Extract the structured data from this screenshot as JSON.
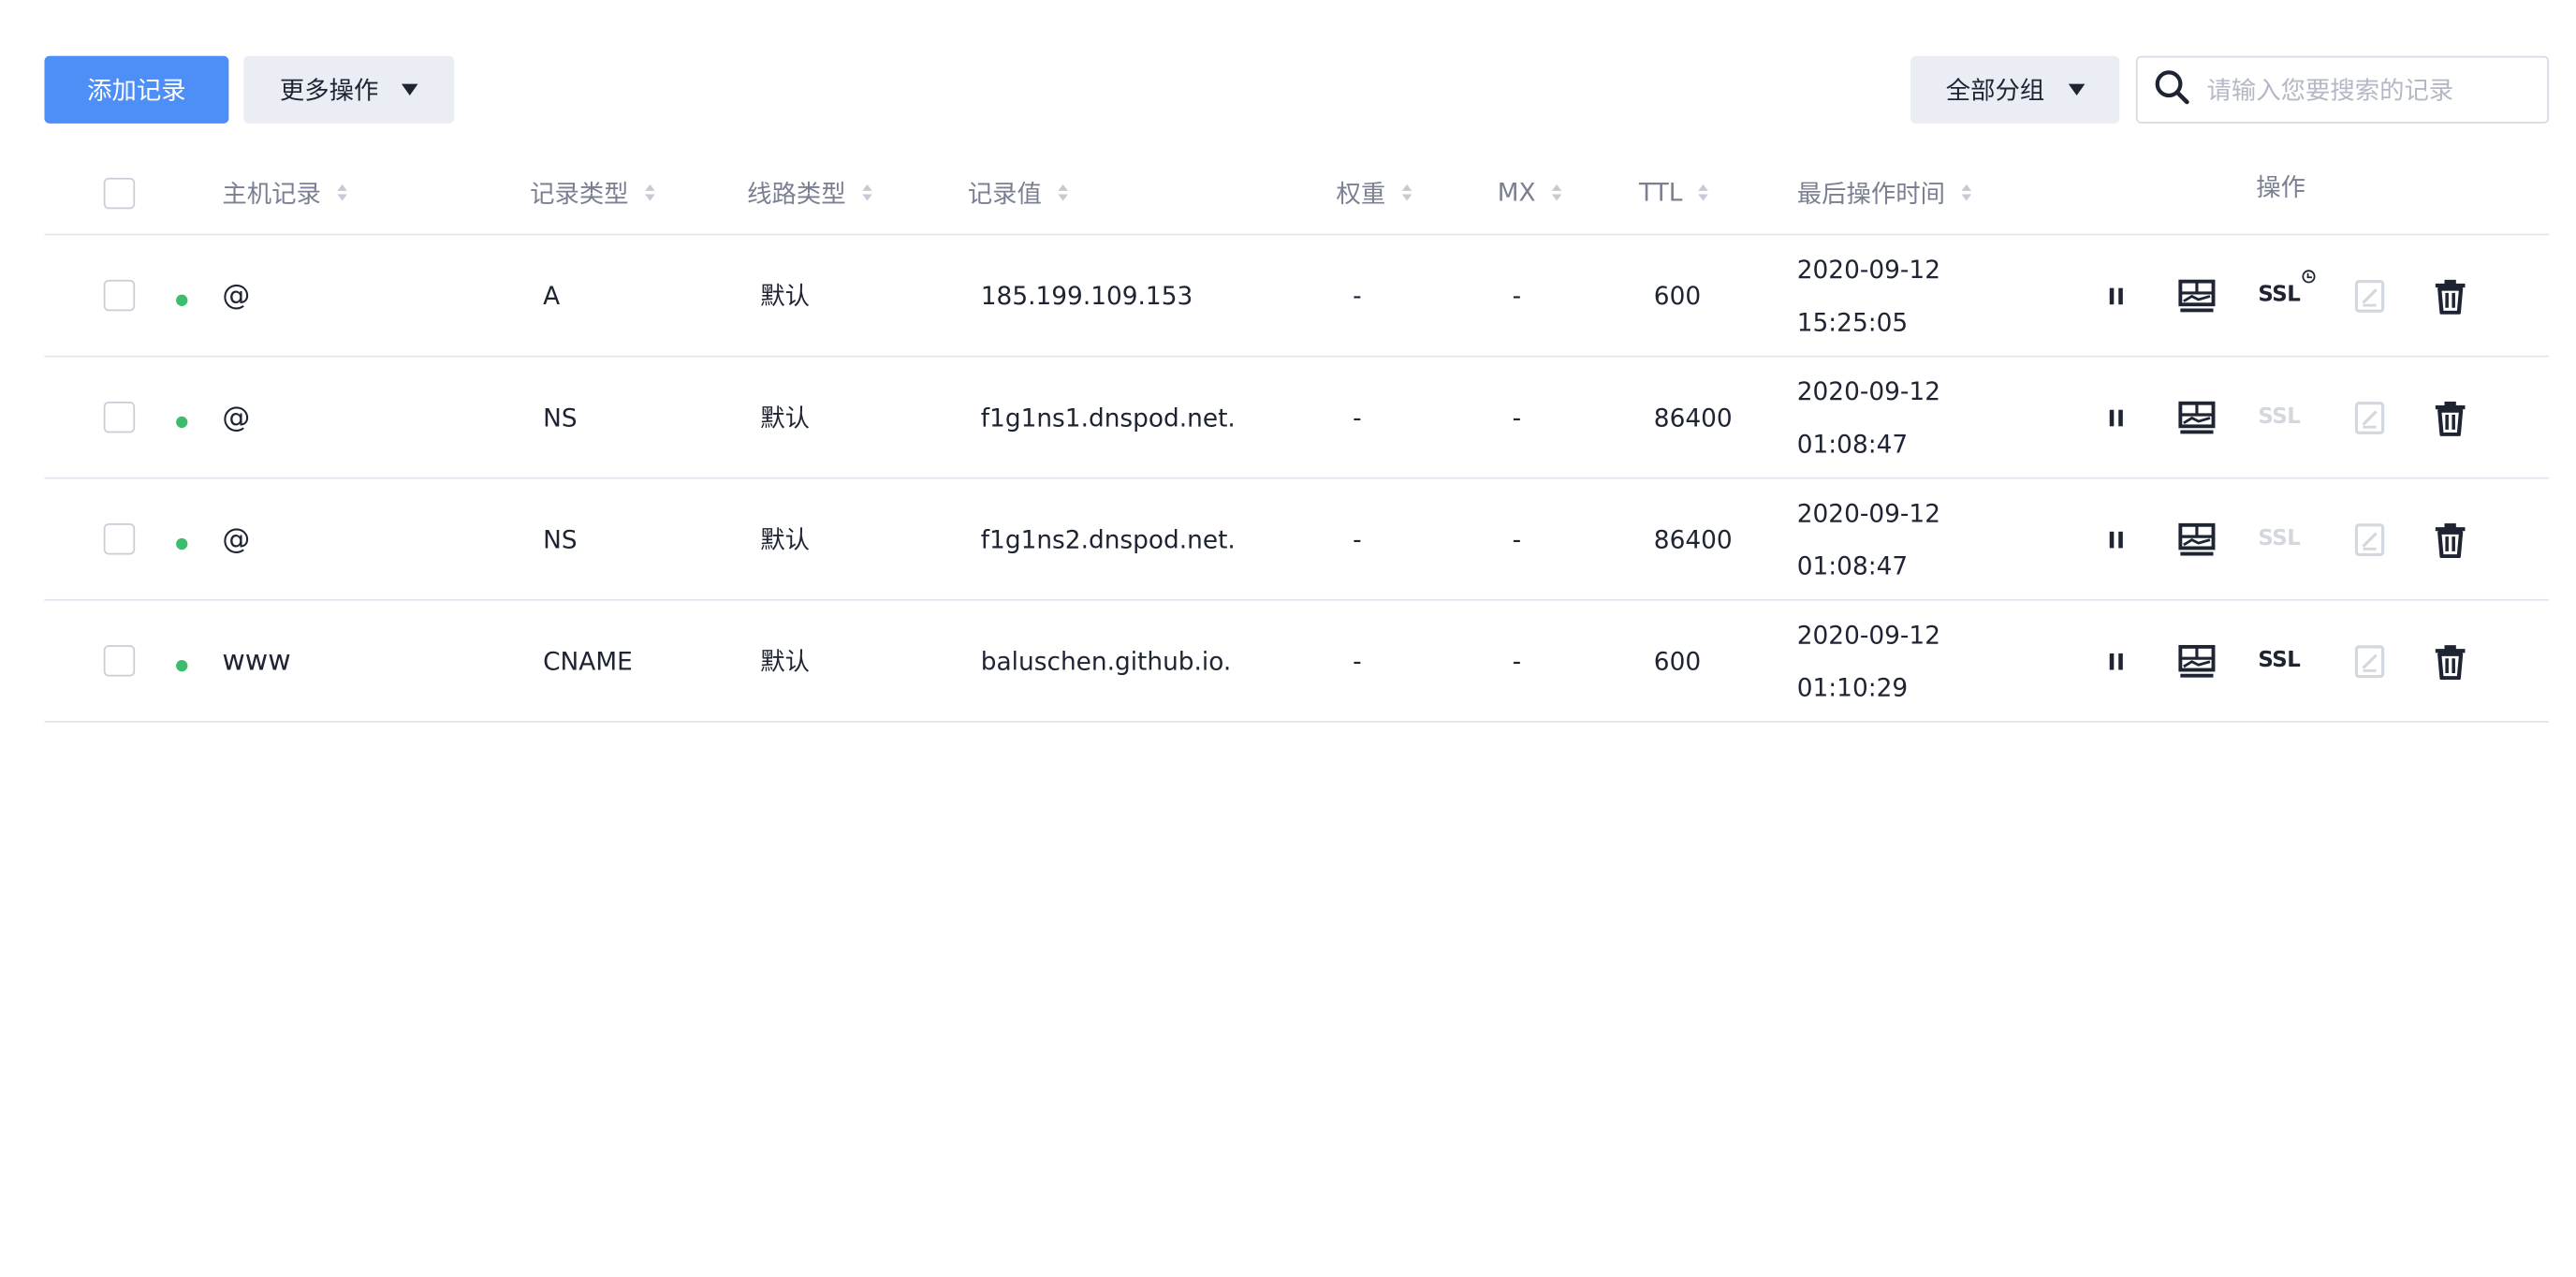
{
  "toolbar": {
    "add_label": "添加记录",
    "more_label": "更多操作",
    "group_label": "全部分组",
    "search_placeholder": "请输入您要搜索的记录"
  },
  "columns": {
    "host": "主机记录",
    "type": "记录类型",
    "line": "线路类型",
    "value": "记录值",
    "weight": "权重",
    "mx": "MX",
    "ttl": "TTL",
    "time": "最后操作时间",
    "ops": "操作"
  },
  "rows": [
    {
      "host": "@",
      "type": "A",
      "line": "默认",
      "value": "185.199.109.153",
      "weight": "-",
      "mx": "-",
      "ttl": "600",
      "date": "2020-09-12",
      "clock": "15:25:05",
      "ssl_state": "pending"
    },
    {
      "host": "@",
      "type": "NS",
      "line": "默认",
      "value": "f1g1ns1.dnspod.net.",
      "weight": "-",
      "mx": "-",
      "ttl": "86400",
      "date": "2020-09-12",
      "clock": "01:08:47",
      "ssl_state": "disabled"
    },
    {
      "host": "@",
      "type": "NS",
      "line": "默认",
      "value": "f1g1ns2.dnspod.net.",
      "weight": "-",
      "mx": "-",
      "ttl": "86400",
      "date": "2020-09-12",
      "clock": "01:08:47",
      "ssl_state": "disabled"
    },
    {
      "host": "www",
      "type": "CNAME",
      "line": "默认",
      "value": "baluschen.github.io.",
      "weight": "-",
      "mx": "-",
      "ttl": "600",
      "date": "2020-09-12",
      "clock": "01:10:29",
      "ssl_state": "enabled"
    }
  ],
  "ssl_text": "SSL",
  "icons": [
    "search-icon",
    "pause-icon",
    "monitor-icon",
    "edit-icon",
    "trash-icon",
    "chevron-down-icon",
    "sort-icon"
  ],
  "colors": {
    "primary": "#4e8ef7",
    "status_on": "#3dbc6d",
    "icon_dark": "#1f2433",
    "icon_disabled": "#d3d7de"
  }
}
